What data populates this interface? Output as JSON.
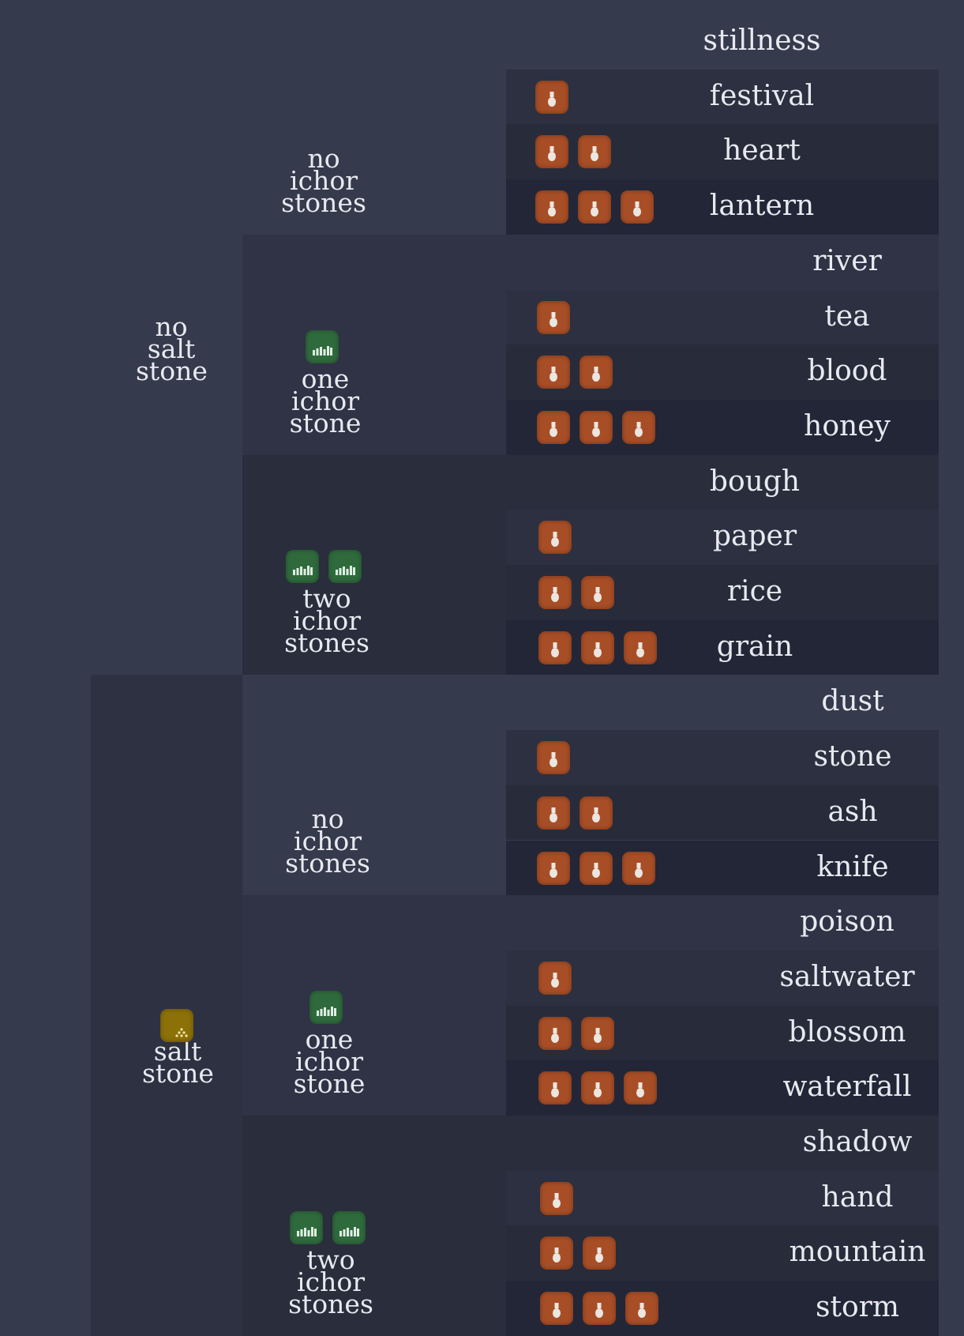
{
  "colors": {
    "background": "#353a4c",
    "vase_tile": "#a84e26",
    "ichor_tile": "#2f6a3c",
    "salt_tile": "#8c7008"
  },
  "icons": {
    "vase": "vase-icon",
    "ichor": "bars-icon",
    "salt": "dots-icon"
  },
  "salt_groups": [
    {
      "label": "no\nsalt\nstone",
      "salt_icons": 0,
      "ichor_groups": [
        {
          "label": "no\nichor\nstones",
          "ichor_icons": 0,
          "words": [
            "stillness",
            "festival",
            "heart",
            "lantern"
          ]
        },
        {
          "label": "one\nichor\nstone",
          "ichor_icons": 1,
          "words": [
            "river",
            "tea",
            "blood",
            "honey"
          ]
        },
        {
          "label": "two\nichor\nstones",
          "ichor_icons": 2,
          "words": [
            "bough",
            "paper",
            "rice",
            "grain"
          ]
        }
      ]
    },
    {
      "label": "salt\nstone",
      "salt_icons": 1,
      "ichor_groups": [
        {
          "label": "no\nichor\nstones",
          "ichor_icons": 0,
          "words": [
            "dust",
            "stone",
            "ash",
            "knife"
          ]
        },
        {
          "label": "one\nichor\nstone",
          "ichor_icons": 1,
          "words": [
            "poison",
            "saltwater",
            "blossom",
            "waterfall"
          ]
        },
        {
          "label": "two\nichor\nstones",
          "ichor_icons": 2,
          "words": [
            "shadow",
            "hand",
            "mountain",
            "storm"
          ]
        }
      ]
    }
  ]
}
